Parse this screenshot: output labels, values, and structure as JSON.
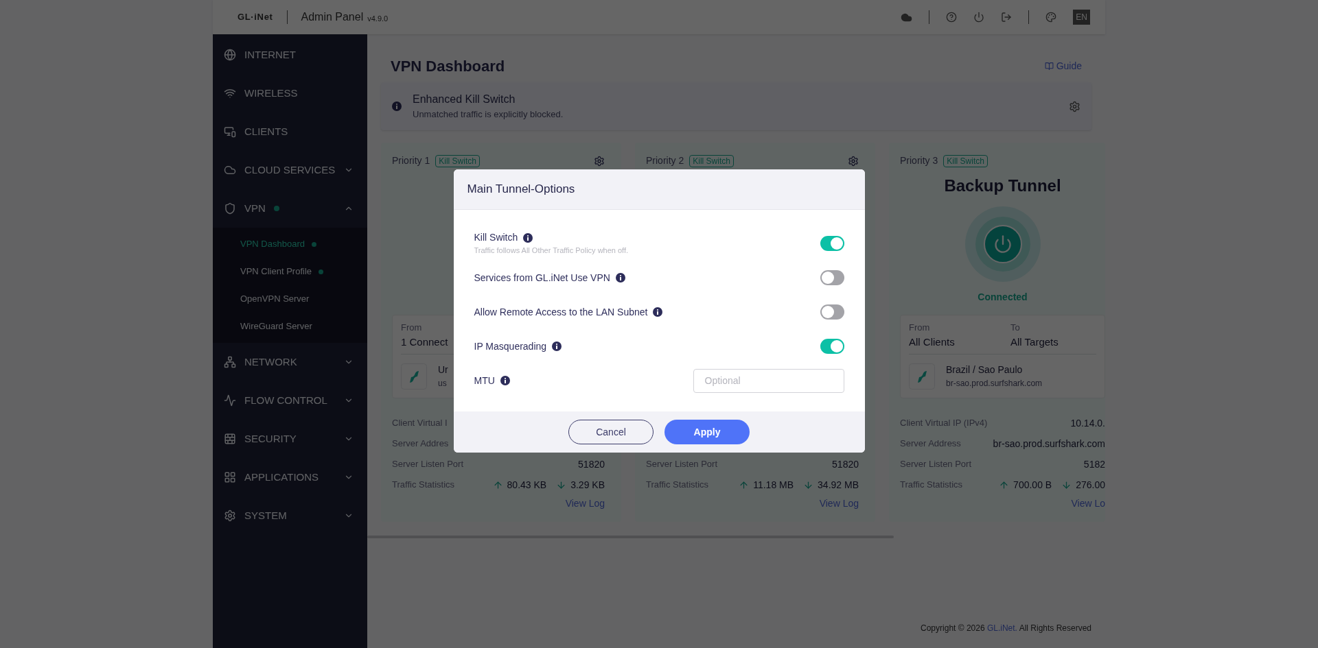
{
  "header": {
    "logo": "GL·iNet",
    "title": "Admin Panel",
    "version": "v4.9.0",
    "language": "EN"
  },
  "sidebar": {
    "items": [
      {
        "label": "INTERNET",
        "kind": "link",
        "dot": false
      },
      {
        "label": "WIRELESS",
        "kind": "link",
        "dot": false
      },
      {
        "label": "CLIENTS",
        "kind": "link",
        "dot": false
      },
      {
        "label": "CLOUD SERVICES",
        "kind": "group",
        "dot": false,
        "expanded": false
      },
      {
        "label": "VPN",
        "kind": "group",
        "dot": true,
        "expanded": true,
        "children": [
          {
            "label": "VPN Dashboard",
            "selected": true,
            "dot": true
          },
          {
            "label": "VPN Client Profile",
            "selected": false,
            "dot": true
          },
          {
            "label": "OpenVPN Server",
            "selected": false,
            "dot": false
          },
          {
            "label": "WireGuard Server",
            "selected": false,
            "dot": false
          }
        ]
      },
      {
        "label": "NETWORK",
        "kind": "group",
        "dot": false,
        "expanded": false
      },
      {
        "label": "FLOW CONTROL",
        "kind": "group",
        "dot": false,
        "expanded": false
      },
      {
        "label": "SECURITY",
        "kind": "group",
        "dot": false,
        "expanded": false
      },
      {
        "label": "APPLICATIONS",
        "kind": "group",
        "dot": false,
        "expanded": false
      },
      {
        "label": "SYSTEM",
        "kind": "group",
        "dot": false,
        "expanded": false
      }
    ]
  },
  "main": {
    "title": "VPN Dashboard",
    "guide": "Guide",
    "banner": {
      "title": "Enhanced Kill Switch",
      "text": "Unmatched traffic is explicitly blocked."
    },
    "cards": [
      {
        "priority": "Priority 1",
        "tag": "Kill Switch",
        "box": {
          "from_label": "From",
          "from_value": "1 Connect",
          "server_name": "Ur",
          "server_host": "us"
        },
        "stats": [
          {
            "label": "Client Virtual I"
          },
          {
            "label": "Server Addres"
          },
          {
            "label": "Server Listen Port",
            "value": "51820"
          },
          {
            "label": "Traffic Statistics",
            "up": "80.43 KB",
            "down": "3.29 KB"
          }
        ],
        "link": "View Log"
      },
      {
        "priority": "Priority 2",
        "tag": "Kill Switch",
        "stats": [
          {
            "label": "Server Listen Port",
            "value": "51820"
          },
          {
            "label": "Traffic Statistics",
            "up": "11.18 MB",
            "down": "34.92 MB"
          }
        ],
        "link": "View Log"
      },
      {
        "priority": "Priority 3",
        "tag": "Kill Switch",
        "hero": {
          "title": "Backup Tunnel",
          "status": "Connected"
        },
        "box": {
          "from_label": "From",
          "from_value": "All Clients",
          "to_label": "To",
          "to_value": "All Targets",
          "server_name": "Brazil / Sao Paulo",
          "server_host": "br-sao.prod.surfshark.com"
        },
        "stats": [
          {
            "label": "Client Virtual IP (IPv4)",
            "value": "10.14.0."
          },
          {
            "label": "Server Address",
            "value": "br-sao.prod.surfshark.com"
          },
          {
            "label": "Server Listen Port",
            "value": "5182"
          },
          {
            "label": "Traffic Statistics",
            "up": "700.00 B",
            "down": "276.00"
          }
        ],
        "link": "View Lo"
      }
    ]
  },
  "footer": {
    "text": "Copyright © 2026 ",
    "link": "GL.iNet.",
    "rest": " All Rights Reserved"
  },
  "dialog": {
    "title": "Main Tunnel-Options",
    "options": [
      {
        "kind": "toggle",
        "label": "Kill Switch",
        "hint": "Traffic follows All Other Traffic Policy when off.",
        "on": true
      },
      {
        "kind": "toggle",
        "label": "Services from GL.iNet Use VPN",
        "on": false
      },
      {
        "kind": "toggle",
        "label": "Allow Remote Access to the LAN Subnet",
        "on": false
      },
      {
        "kind": "toggle",
        "label": "IP Masquerading",
        "on": true
      },
      {
        "kind": "input",
        "label": "MTU",
        "placeholder": "Optional"
      }
    ],
    "buttons": [
      "Cancel",
      "Apply"
    ]
  }
}
